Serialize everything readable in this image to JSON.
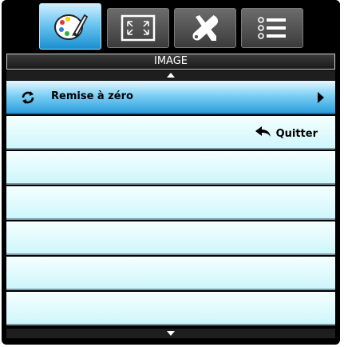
{
  "header": {
    "title": "IMAGE"
  },
  "tabs": [
    {
      "icon": "palette-icon",
      "active": true
    },
    {
      "icon": "resize-screen-icon",
      "active": false
    },
    {
      "icon": "tools-icon",
      "active": false
    },
    {
      "icon": "options-list-icon",
      "active": false
    }
  ],
  "menu": {
    "items": [
      {
        "label": "Remise à zéro",
        "icon": "reset-icon",
        "selected": true
      }
    ],
    "exit_label": "Quitter",
    "exit_icon": "return-arrow-icon"
  },
  "colors": {
    "accent_blue": "#2d9fdd",
    "row_bg": "#cdf6fb",
    "frame": "#000000"
  }
}
